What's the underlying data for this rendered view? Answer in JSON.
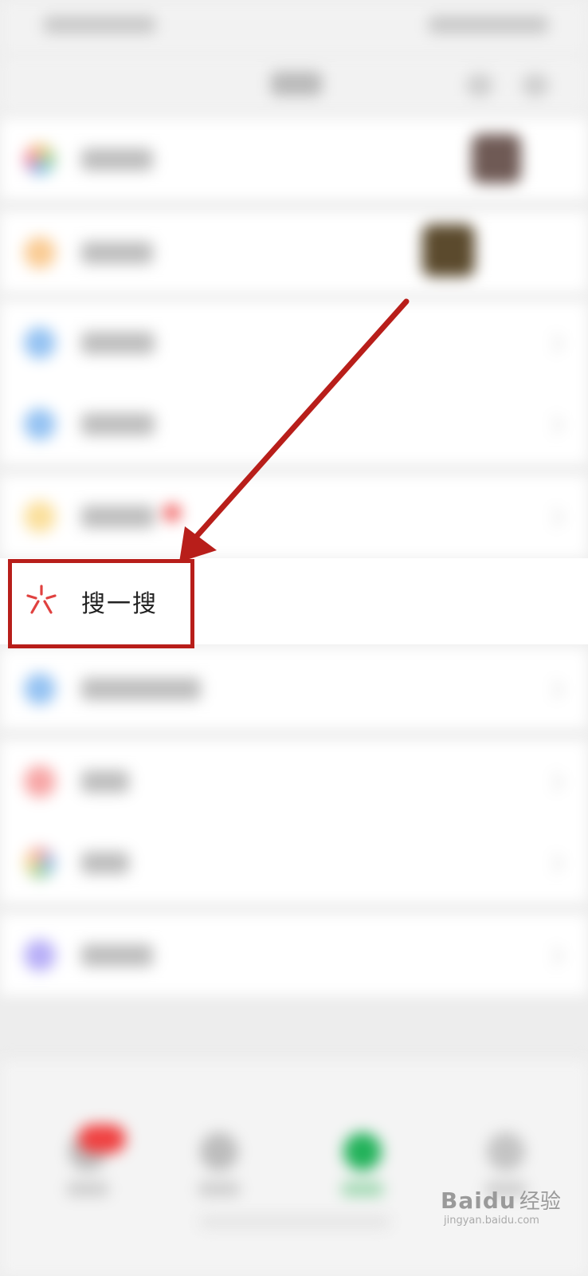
{
  "search_item": {
    "label": "搜一搜",
    "icon": "search-star-icon",
    "icon_color": "#e0413f"
  },
  "annotation": {
    "box_color": "#b81e1a",
    "arrow_color": "#b81e1a"
  },
  "watermark": {
    "brand": "Baidu",
    "suffix": "经验",
    "url": "jingyan.baidu.com"
  },
  "blurred_menu_icons": [
    "moments-icon",
    "channels-icon",
    "scan-icon",
    "shake-icon",
    "top-stories-icon",
    "search-star-icon",
    "nearby-icon",
    "shopping-icon",
    "games-icon",
    "mini-programs-icon"
  ],
  "colors": {
    "background": "#ededed",
    "row_background": "#ffffff"
  }
}
